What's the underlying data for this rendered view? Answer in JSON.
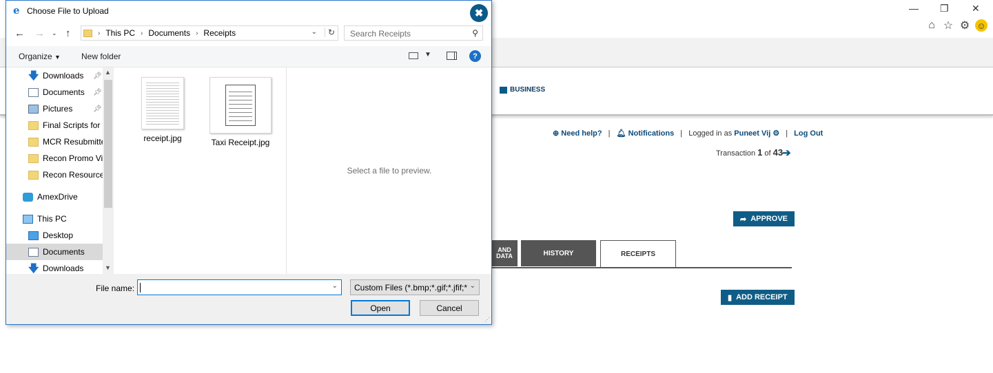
{
  "browser": {
    "minimize": "—",
    "restore": "❐",
    "close": "✕"
  },
  "site": {
    "business_nav": "BUSINESS",
    "need_help": "Need help?",
    "notifications": "Notifications",
    "logged_in_as": "Logged in as",
    "user": "Puneet Vij",
    "logout": "Log Out",
    "transaction_label": "Transaction",
    "transaction_current": "1",
    "transaction_of": "of",
    "transaction_total": "43",
    "approve": "APPROVE",
    "tabs": [
      "AND DATA",
      "HISTORY",
      "RECEIPTS"
    ],
    "add_receipt": "ADD RECEIPT"
  },
  "dialog": {
    "title": "Choose File to Upload",
    "breadcrumb": [
      "This PC",
      "Documents",
      "Receipts"
    ],
    "search_placeholder": "Search Receipts",
    "organize": "Organize",
    "new_folder": "New folder",
    "nav_items": [
      {
        "label": "Downloads",
        "icon": "download-arrow-icon",
        "pinned": true
      },
      {
        "label": "Documents",
        "icon": "documents-icon",
        "pinned": true
      },
      {
        "label": "Pictures",
        "icon": "pictures-icon",
        "pinned": true
      },
      {
        "label": "Final Scripts for S",
        "icon": "folder-icon"
      },
      {
        "label": "MCR Resubmitte",
        "icon": "folder-icon"
      },
      {
        "label": "Recon Promo Vi",
        "icon": "folder-icon"
      },
      {
        "label": "Recon Resource",
        "icon": "folder-icon"
      },
      {
        "label": "AmexDrive",
        "icon": "cloud-drive-icon"
      },
      {
        "label": "This PC",
        "icon": "computer-icon"
      },
      {
        "label": "Desktop",
        "icon": "desktop-icon"
      },
      {
        "label": "Documents",
        "icon": "documents-icon"
      },
      {
        "label": "Downloads",
        "icon": "download-arrow-icon"
      }
    ],
    "files": [
      {
        "name": "receipt.jpg"
      },
      {
        "name": "Taxi Receipt.jpg"
      }
    ],
    "preview_text": "Select a file to preview.",
    "file_name_label": "File name:",
    "file_name_value": "",
    "file_type": "Custom Files (*.bmp;*.gif;*.jfif;*",
    "open": "Open",
    "cancel": "Cancel"
  },
  "colors": {
    "accent_blue": "#0f5d86",
    "focus_blue": "#0078d7"
  }
}
